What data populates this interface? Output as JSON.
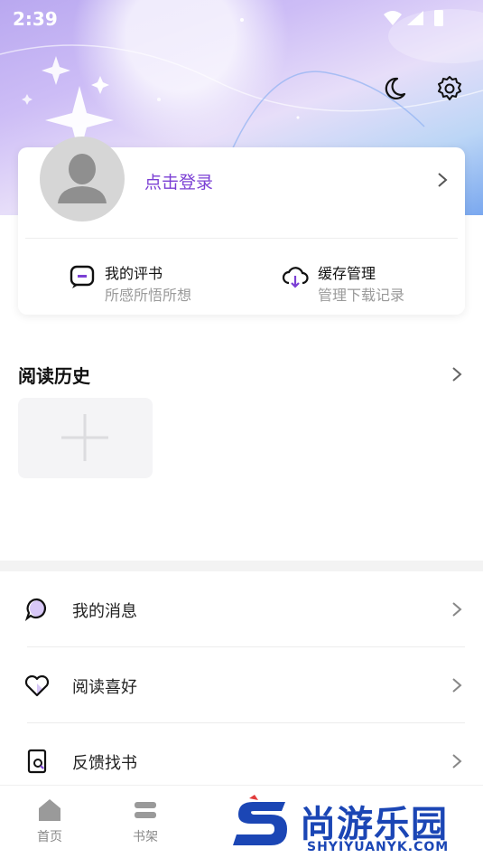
{
  "status_bar": {
    "time": "2:39"
  },
  "profile": {
    "login_text": "点击登录",
    "quick_actions": [
      {
        "title": "我的评书",
        "subtitle": "所感所悟所想",
        "icon": "review-bubble-icon"
      },
      {
        "title": "缓存管理",
        "subtitle": "管理下载记录",
        "icon": "cloud-download-icon"
      }
    ]
  },
  "history": {
    "title": "阅读历史"
  },
  "menu": [
    {
      "label": "我的消息",
      "icon": "message-bubble-icon"
    },
    {
      "label": "阅读喜好",
      "icon": "heart-icon"
    },
    {
      "label": "反馈找书",
      "icon": "book-search-icon"
    }
  ],
  "tabs": [
    {
      "label": "首页",
      "icon": "home-icon"
    },
    {
      "label": "书架",
      "icon": "bookshelf-icon"
    }
  ],
  "watermark": {
    "brand": "尚游乐园",
    "url": "SHYIYUANYK.COM"
  },
  "colors": {
    "accent": "#7b3fd4",
    "watermark": "#1b46b5"
  }
}
